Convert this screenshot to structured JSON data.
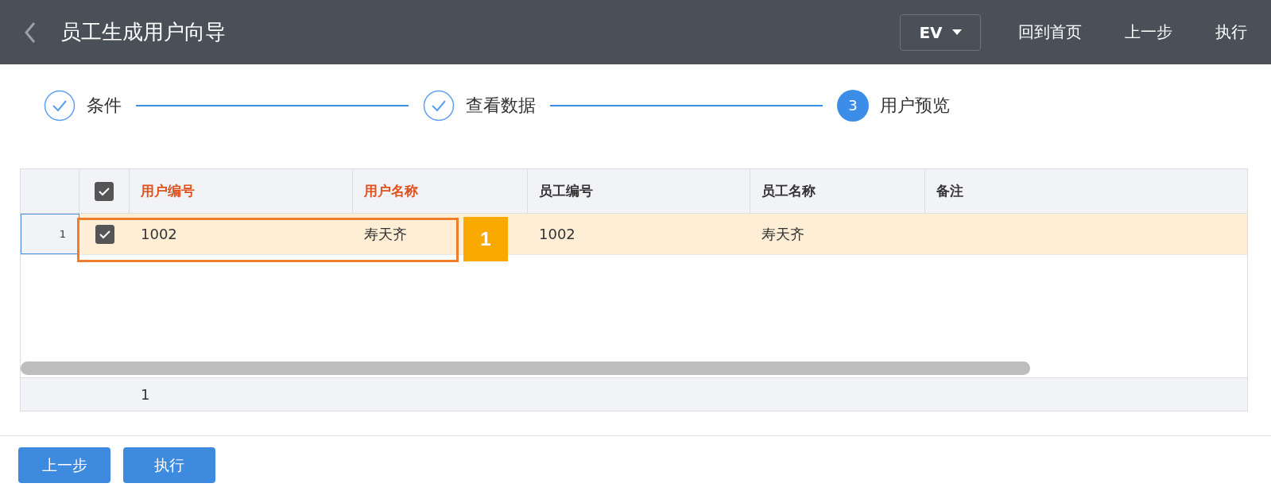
{
  "header": {
    "title": "员工生成用户向导",
    "language": "EV",
    "actions": [
      "回到首页",
      "上一步",
      "执行"
    ]
  },
  "steps": [
    {
      "label": "条件",
      "kind": "done"
    },
    {
      "label": "查看数据",
      "kind": "done"
    },
    {
      "label": "用户预览",
      "kind": "current",
      "number": "3"
    }
  ],
  "table": {
    "all_checked": true,
    "columns": [
      {
        "label": "用户编号",
        "highlighted": true
      },
      {
        "label": "用户名称",
        "highlighted": true
      },
      {
        "label": "员工编号",
        "highlighted": false
      },
      {
        "label": "员工名称",
        "highlighted": false
      },
      {
        "label": "备注",
        "highlighted": false
      }
    ],
    "rows": [
      {
        "number": "1",
        "checked": true,
        "selected": true,
        "cells": [
          "1002",
          "寿天齐",
          "1002",
          "寿天齐",
          ""
        ]
      }
    ],
    "footer": {
      "count": "1"
    }
  },
  "callout": {
    "label": "1"
  },
  "buttons": [
    "上一步",
    "执行"
  ]
}
